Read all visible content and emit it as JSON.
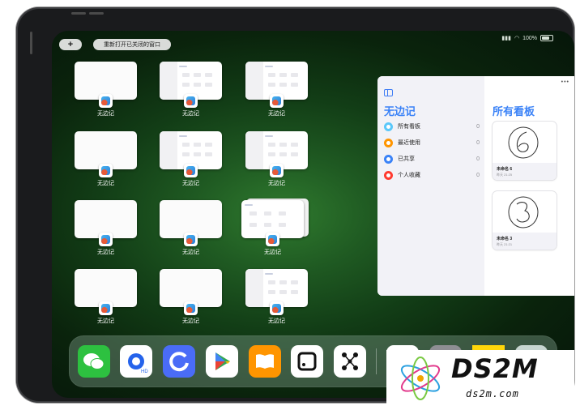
{
  "status_bar": {
    "battery": "100%"
  },
  "top_buttons": {
    "plus": "+",
    "reopen_closed": "重新打开已关闭的窗口"
  },
  "windows": [
    {
      "label": "无边记"
    },
    {
      "label": "无边记"
    },
    {
      "label": "无边记"
    },
    {
      "label": "无边记"
    },
    {
      "label": "无边记"
    },
    {
      "label": "无边记"
    },
    {
      "label": "无边记"
    },
    {
      "label": "无边记"
    },
    {
      "label": "无边记"
    },
    {
      "label": "无边记"
    },
    {
      "label": "无边记"
    },
    {
      "label": "无边记"
    }
  ],
  "panel": {
    "more": "•••",
    "sidebar_title": "无边记",
    "items": [
      {
        "label": "所有看板",
        "count": "0",
        "icon": "boards-icon",
        "color": "#5ac8fa"
      },
      {
        "label": "最近使用",
        "count": "0",
        "icon": "clock-icon",
        "color": "#ff9500"
      },
      {
        "label": "已共享",
        "count": "0",
        "icon": "shared-people-icon",
        "color": "#3a82f7"
      },
      {
        "label": "个人收藏",
        "count": "0",
        "icon": "heart-icon",
        "color": "#ff3b30"
      }
    ],
    "main_title": "所有看板",
    "boards": [
      {
        "name": "未命名 6",
        "date": "昨天 21:25",
        "sketch": "6"
      },
      {
        "name": "未命名 3",
        "date": "昨天 21:21",
        "sketch": "3"
      }
    ]
  },
  "dock": {
    "apps": [
      {
        "name": "WeChat",
        "icon": "wechat-icon",
        "color": "#2dc140"
      },
      {
        "name": "Browser HD",
        "icon": "browser-hd-icon",
        "color": "#ffffff",
        "badge": "HD"
      },
      {
        "name": "Refresh app",
        "icon": "refresh-app-icon",
        "color": "#4a6cf7"
      },
      {
        "name": "Play",
        "icon": "play-store-icon",
        "color": "#ffffff"
      },
      {
        "name": "Books",
        "icon": "books-icon",
        "color": "#ff9500"
      },
      {
        "name": "Square app",
        "icon": "square-app-icon",
        "color": "#ffffff"
      },
      {
        "name": "Graph app",
        "icon": "graph-app-icon",
        "color": "#ffffff"
      },
      {
        "name": "Freeform",
        "icon": "freeform-icon",
        "color": "#ffffff"
      },
      {
        "name": "Settings",
        "icon": "settings-icon",
        "color": "#8e8e93"
      },
      {
        "name": "Notes",
        "icon": "notes-icon",
        "color": "#ffd60a"
      },
      {
        "name": "App folder",
        "icon": "folder-icon",
        "color": "#c7d5d0"
      }
    ]
  },
  "watermark": {
    "title": "DS2M",
    "subtitle": "ds2m.com"
  }
}
